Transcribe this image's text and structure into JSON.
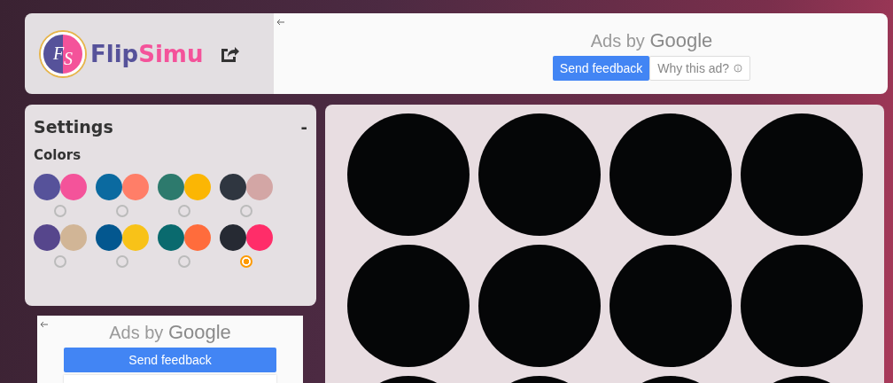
{
  "header": {
    "logo_initials": [
      "F",
      "S"
    ],
    "brand": {
      "first": "Flip",
      "second": "Simu"
    }
  },
  "top_ad": {
    "label": "Ads by",
    "brand": "Google",
    "buttons": [
      {
        "kind": "primary",
        "label": "Send feedback"
      },
      {
        "kind": "secondary",
        "label": "Why this ad?"
      }
    ]
  },
  "settings": {
    "title": "Settings",
    "collapse": "-",
    "section": "Colors",
    "palettes": [
      {
        "swatches": [
          {
            "color": "#56529a"
          },
          {
            "color": "#f4539a"
          }
        ],
        "selected": false
      },
      {
        "swatches": [
          {
            "color": "#0b6aa0"
          },
          {
            "color": "#ff7e68"
          }
        ],
        "selected": false
      },
      {
        "swatches": [
          {
            "color": "#2d7a6d"
          },
          {
            "color": "#fbb604"
          }
        ],
        "selected": false
      },
      {
        "swatches": [
          {
            "color": "#2f3640"
          },
          {
            "color": "#d3a6a5"
          }
        ],
        "selected": false
      },
      {
        "swatches": [
          {
            "color": "#56468c"
          },
          {
            "color": "#d1b596"
          }
        ],
        "selected": false
      },
      {
        "swatches": [
          {
            "color": "#03578f"
          },
          {
            "color": "#f8c218"
          }
        ],
        "selected": false
      },
      {
        "swatches": [
          {
            "color": "#0a6a6e"
          },
          {
            "color": "#ff6c3c"
          }
        ],
        "selected": false
      },
      {
        "swatches": [
          {
            "color": "#262a33"
          },
          {
            "color": "#ff2d69"
          }
        ],
        "selected": true
      }
    ]
  },
  "side_ad": {
    "label": "Ads by",
    "brand": "Google",
    "buttons": [
      {
        "kind": "primary",
        "label": "Send feedback"
      }
    ]
  }
}
